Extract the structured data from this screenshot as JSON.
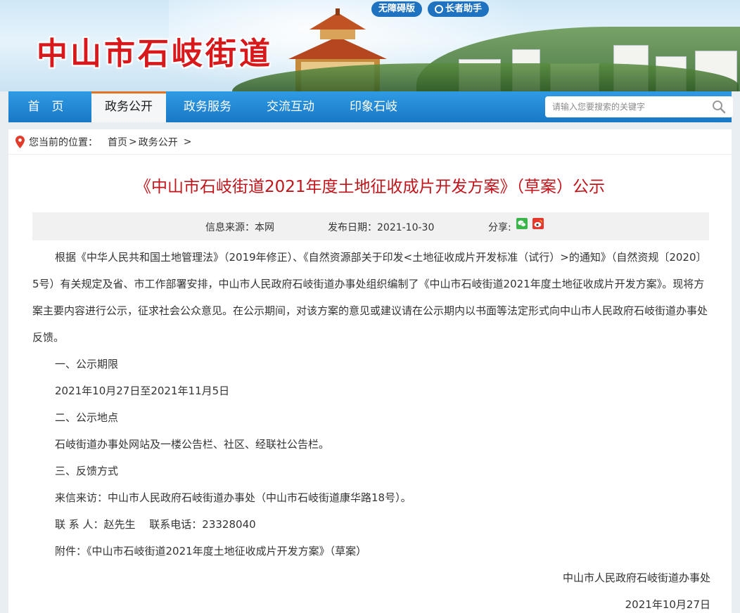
{
  "site": {
    "title": "中山市石岐街道",
    "accessibility_link": "无障碍版",
    "elder_link": "长者助手"
  },
  "nav": {
    "items": [
      {
        "label": "首　页"
      },
      {
        "label": "政务公开"
      },
      {
        "label": "政务服务"
      },
      {
        "label": "交流互动"
      },
      {
        "label": "印象石岐"
      }
    ],
    "active_index": 1,
    "search_placeholder": "请输入您要搜索的关键字"
  },
  "breadcrumb": {
    "prefix": "您当前的位置：",
    "items": [
      "首页",
      "政务公开"
    ],
    "separator": ">"
  },
  "article": {
    "title": "《中山市石岐街道2021年度土地征收成片开发方案》（草案）公示",
    "source": "信息来源：本网",
    "date": "发布日期：2021-10-30",
    "share_label": "分享:",
    "paragraphs": {
      "intro": "根据《中华人民共和国土地管理法》（2019年修正）、《自然资源部关于印发<土地征收成片开发标准（试行）>的通知》（自然资规〔2020〕5号）有关规定及省、市工作部署安排，中山市人民政府石岐街道办事处组织编制了《中山市石岐街道2021年度土地征收成片开发方案》。现将方案主要内容进行公示，征求社会公众意见。在公示期间，对该方案的意见或建议请在公示期内以书面等法定形式向中山市人民政府石岐街道办事处反馈。",
      "h1": "一、公示期限",
      "period": "2021年10月27日至2021年11月5日",
      "h2": "二、公示地点",
      "place": "石岐街道办事处网站及一楼公告栏、社区、经联社公告栏。",
      "h3": "三、反馈方式",
      "letter": "来信来访：中山市人民政府石岐街道办事处（中山市石岐街道康华路18号）。",
      "contact": "联 系 人：赵先生　 联系电话：23328040",
      "attachment": "附件：《中山市石岐街道2021年度土地征收成片开发方案》（草案）",
      "signature": "中山市人民政府石岐街道办事处",
      "sign_date": "2021年10月27日"
    }
  },
  "colors": {
    "brand_red": "#d8191c",
    "nav_blue": "#1978c6",
    "active_accent": "#e47321"
  }
}
